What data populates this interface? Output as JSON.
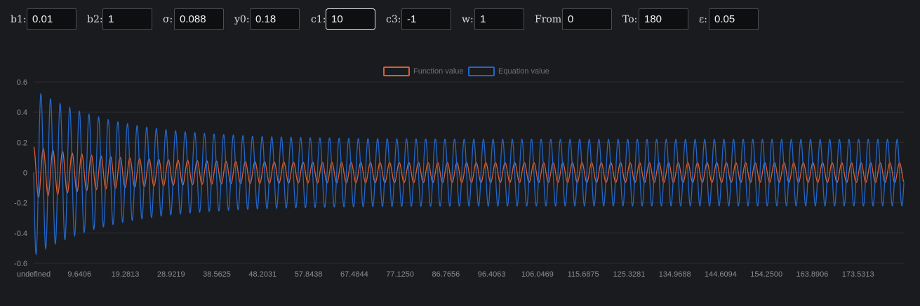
{
  "controls": [
    {
      "id": "b1",
      "label": "b1:",
      "value": "0.01"
    },
    {
      "id": "b2",
      "label": "b2:",
      "value": "1"
    },
    {
      "id": "sigma",
      "label": "σ:",
      "value": "0.088"
    },
    {
      "id": "y0",
      "label": "y0:",
      "value": "0.18"
    },
    {
      "id": "c1",
      "label": "c1:",
      "value": "10",
      "focused": true
    },
    {
      "id": "c3",
      "label": "c3:",
      "value": "-1"
    },
    {
      "id": "w",
      "label": "w:",
      "value": "1"
    },
    {
      "id": "from",
      "label": "From:",
      "value": "0"
    },
    {
      "id": "to",
      "label": "To:",
      "value": "180"
    },
    {
      "id": "eps",
      "label": "ε:",
      "value": "0.05"
    }
  ],
  "chart_data": {
    "type": "line",
    "x_range": [
      0,
      180
    ],
    "ylim": [
      -0.6,
      0.6
    ],
    "y_ticks": [
      "0.6",
      "0.4",
      "0.2",
      "0",
      "-0.2",
      "-0.4",
      "-0.6"
    ],
    "x_ticks": [
      "undefined",
      "9.6406",
      "19.2813",
      "28.9219",
      "38.5625",
      "48.2031",
      "57.8438",
      "67.4844",
      "77.1250",
      "86.7656",
      "96.4063",
      "106.0469",
      "115.6875",
      "125.3281",
      "134.9688",
      "144.6094",
      "154.2500",
      "163.8906",
      "173.5313"
    ],
    "grid": true,
    "legend_position": "top-center",
    "series": [
      {
        "name": "Function value",
        "color": "#d85f33",
        "start": 0.18,
        "initial_amplitude": 0.17,
        "steady_amplitude": 0.065,
        "period": 1.99,
        "decay": 0.06
      },
      {
        "name": "Equation value",
        "color": "#2266c8",
        "start": 0.0,
        "initial_amplitude": 0.55,
        "steady_amplitude": 0.22,
        "period": 1.99,
        "decay": 0.06
      }
    ]
  }
}
